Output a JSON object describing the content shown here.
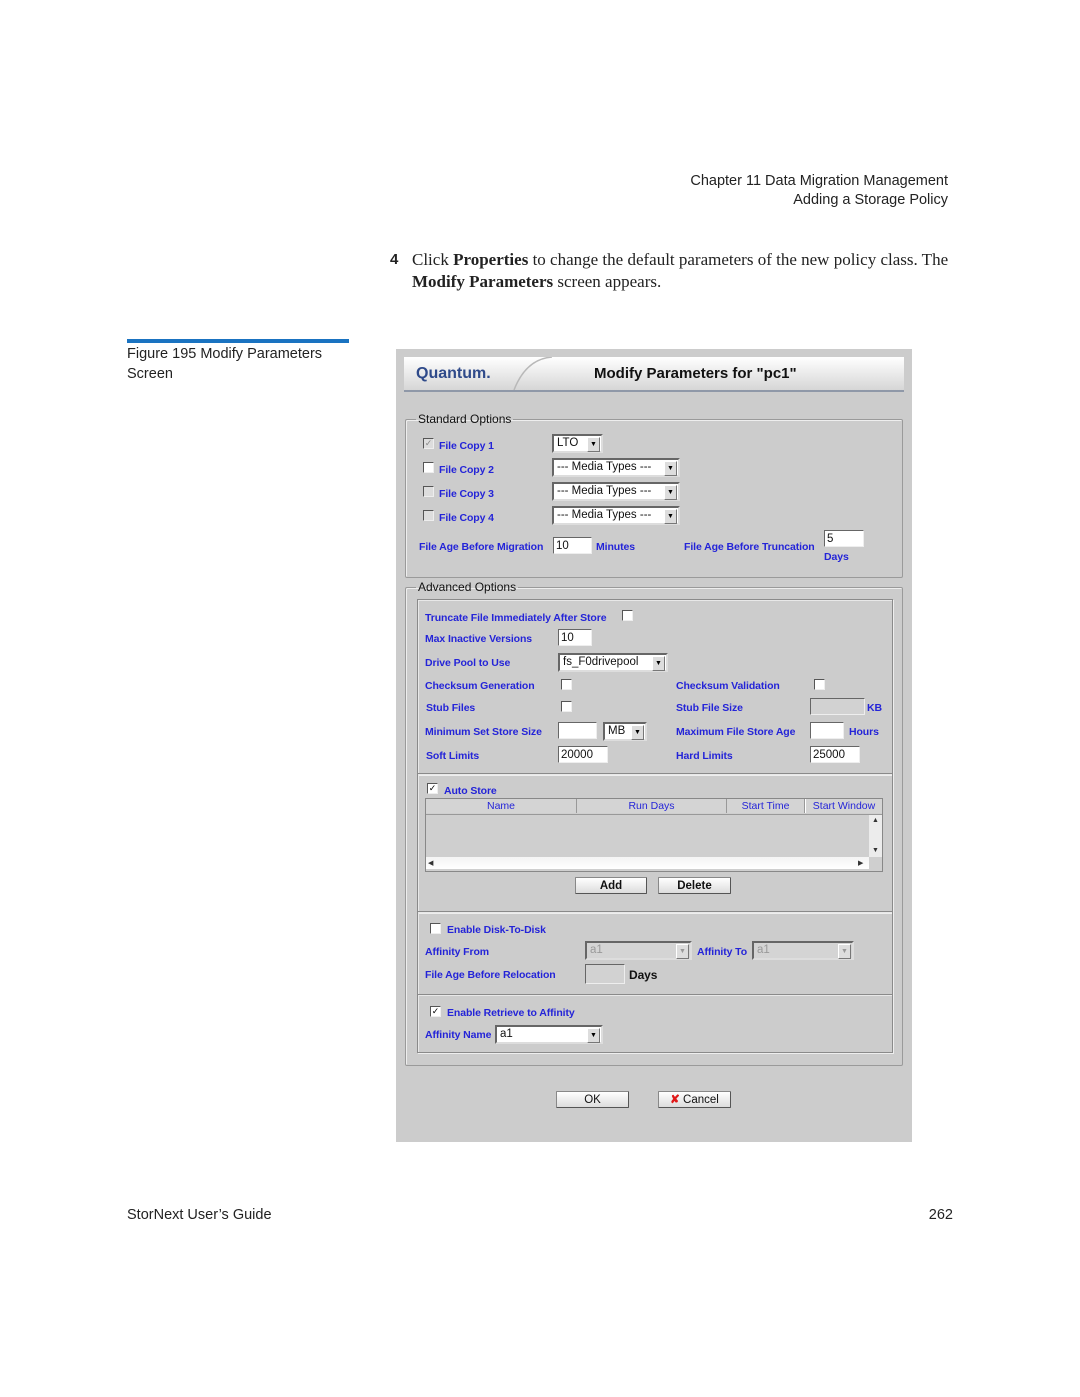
{
  "header": {
    "chapter": "Chapter 11  Data Migration Management",
    "section": "Adding a Storage Policy"
  },
  "step": {
    "number": "4",
    "text_parts": [
      "Click ",
      "Properties",
      " to change the default parameters of the new policy class. The ",
      "Modify Parameters",
      " screen appears."
    ]
  },
  "figure": {
    "caption": "Figure 195  Modify Parameters Screen"
  },
  "footer": {
    "guide": "StorNext User’s Guide",
    "page": "262"
  },
  "dialog": {
    "logo": "Quantum.",
    "title": "Modify Parameters for \"pc1\"",
    "standard": {
      "legend": "Standard Options",
      "copies": [
        {
          "label": "File Copy 1",
          "checked": true,
          "disabled": true,
          "media": "LTO"
        },
        {
          "label": "File Copy 2",
          "checked": false,
          "disabled": false,
          "media": "--- Media Types ---"
        },
        {
          "label": "File Copy 3",
          "checked": false,
          "disabled": true,
          "media": "--- Media Types ---"
        },
        {
          "label": "File Copy 4",
          "checked": false,
          "disabled": true,
          "media": "--- Media Types ---"
        }
      ],
      "age_migration_label": "File Age Before Migration",
      "age_migration_value": "10",
      "age_migration_unit": "Minutes",
      "age_truncation_label": "File Age Before Truncation",
      "age_truncation_value": "5",
      "age_truncation_unit": "Days"
    },
    "advanced": {
      "legend": "Advanced Options",
      "truncate_label": "Truncate File Immediately After Store",
      "truncate_checked": false,
      "max_inactive_label": "Max Inactive Versions",
      "max_inactive_value": "10",
      "drive_pool_label": "Drive Pool to Use",
      "drive_pool_value": "fs_F0drivepool",
      "checksum_gen_label": "Checksum Generation",
      "checksum_gen_checked": false,
      "checksum_val_label": "Checksum Validation",
      "checksum_val_checked": false,
      "stub_files_label": "Stub Files",
      "stub_files_checked": false,
      "stub_size_label": "Stub File Size",
      "stub_size_value": "",
      "stub_size_unit": "KB",
      "min_set_label": "Minimum Set Store Size",
      "min_set_value": "",
      "min_set_unit": "MB",
      "max_age_label": "Maximum File Store Age",
      "max_age_value": "",
      "max_age_unit": "Hours",
      "soft_label": "Soft Limits",
      "soft_value": "20000",
      "hard_label": "Hard Limits",
      "hard_value": "25000",
      "auto_store_label": "Auto Store",
      "auto_store_checked": true,
      "table_columns": [
        "Name",
        "Run Days",
        "Start Time",
        "Start Window"
      ],
      "table_rows": [],
      "add_label": "Add",
      "delete_label": "Delete",
      "d2d_label": "Enable Disk-To-Disk",
      "d2d_checked": false,
      "affinity_from_label": "Affinity From",
      "affinity_from_value": "a1",
      "affinity_to_label": "Affinity To",
      "affinity_to_value": "a1",
      "relocation_label": "File Age Before Relocation",
      "relocation_value": "",
      "relocation_unit": "Days",
      "retrieve_label": "Enable Retrieve to Affinity",
      "retrieve_checked": true,
      "affinity_name_label": "Affinity Name",
      "affinity_name_value": "a1"
    },
    "ok_label": "OK",
    "cancel_label": "Cancel"
  }
}
